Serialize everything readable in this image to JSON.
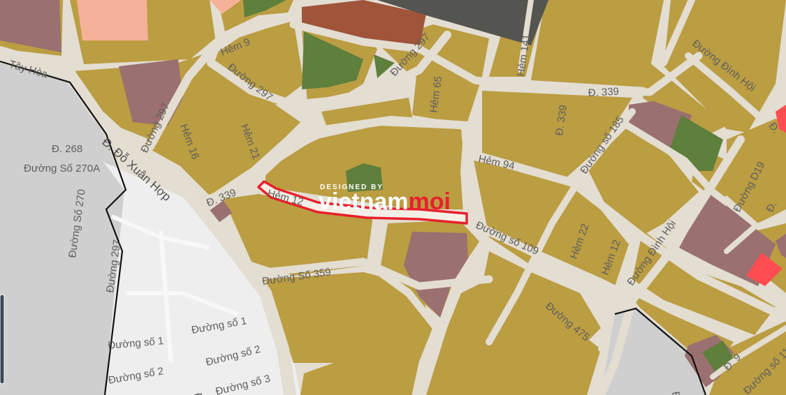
{
  "map": {
    "colors": {
      "land": "#bb9d42",
      "road": "#e3ddd2",
      "outside": "#cfcfcf",
      "outside_light": "#eeeeee",
      "green": "#5f7f3c",
      "mauve": "#9a7070",
      "orange": "#a0543a",
      "peach": "#f6b199",
      "dark_block": "#545450",
      "red_highlight": "#ff4d52",
      "route": "#e8202c",
      "boundary": "#111111"
    },
    "highlighted_street": "Hẻm 12",
    "street_labels": [
      "Tây Hòa",
      "Hẻm 9",
      "Đường 297",
      "Đường 297",
      "Đường 297",
      "Hẻm 65",
      "Hẻm 141",
      "Đ. 339",
      "Đường Đình Hội",
      "Đ. 339",
      "Đường số 185",
      "Đ. 268",
      "Đường Số 270A",
      "Đường Số 270",
      "Đường 297",
      "Hẻm 16",
      "Hẻm 21",
      "Đ. Đỗ Xuân Hợp",
      "Đ. 339",
      "Hẻm 12",
      "Hẻm 94",
      "Đường D19",
      "Đường số 109",
      "Hẻm 22",
      "Hẻm 12",
      "Đường Đình Hội",
      "Đường Số 359",
      "Đường 475",
      "Đường số 1",
      "Đường số 1",
      "Đường số 2",
      "Đường số 2",
      "Đường số 3",
      "Đ. 9",
      "Đường số 11",
      "Đ.",
      "Đ.",
      "Đ",
      "Đ"
    ],
    "watermark": {
      "top": "DESIGNED BY",
      "brand_left": "viet",
      "brand_mid": "nam",
      "brand_right": "moi"
    }
  }
}
